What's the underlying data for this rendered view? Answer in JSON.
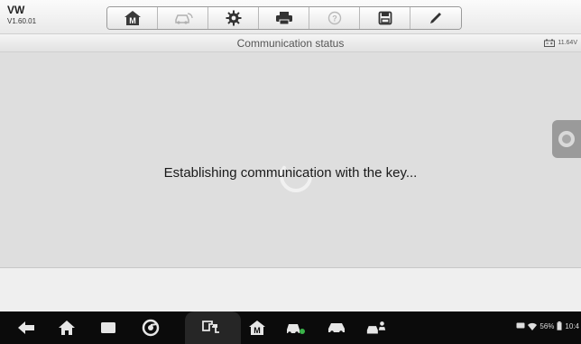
{
  "app": {
    "vehicle": "VW",
    "version": "V1.60.01"
  },
  "toolbar": {
    "buttons": [
      {
        "name": "home",
        "icon": "home-m-icon"
      },
      {
        "name": "vehicle",
        "icon": "car-swap-icon"
      },
      {
        "name": "settings",
        "icon": "gear-icon"
      },
      {
        "name": "print",
        "icon": "printer-icon"
      },
      {
        "name": "help",
        "icon": "help-icon"
      },
      {
        "name": "save",
        "icon": "save-icon"
      },
      {
        "name": "edit",
        "icon": "pen-icon"
      }
    ]
  },
  "status_header": {
    "title": "Communication status",
    "battery_voltage": "11.64V"
  },
  "main": {
    "message": "Establishing communication with the key..."
  },
  "system_bar": {
    "battery_percent": "56%",
    "time": "10:4"
  },
  "colors": {
    "content_bg": "#dedede",
    "navbar_bg": "#0b0b0b"
  }
}
